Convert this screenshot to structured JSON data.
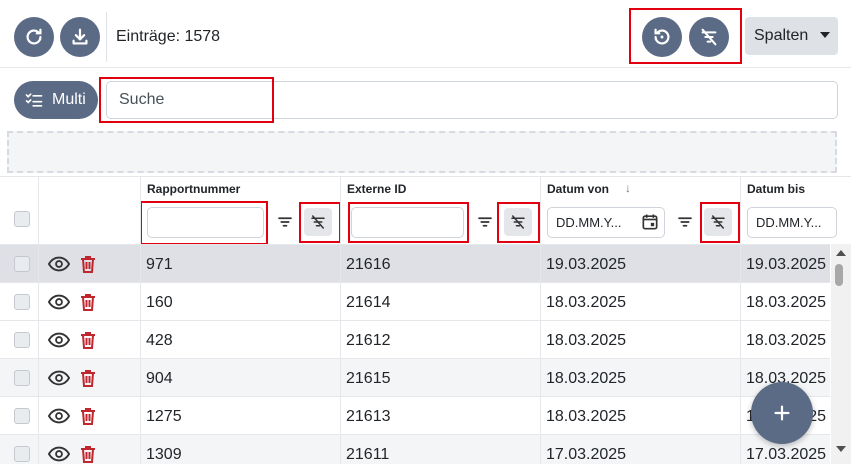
{
  "toolbar": {
    "entries_label": "Einträge: 1578",
    "columns_button_label": "Spalten"
  },
  "search": {
    "multi_label": "Multi",
    "placeholder": "Suche"
  },
  "table": {
    "columns": [
      {
        "key": "rapport",
        "label": "Rapportnummer",
        "filter_value": ""
      },
      {
        "key": "extern",
        "label": "Externe ID",
        "filter_value": ""
      },
      {
        "key": "von",
        "label": "Datum von",
        "filter_placeholder": "DD.MM.Y...",
        "sorted": "descending"
      },
      {
        "key": "bis",
        "label": "Datum bis",
        "filter_placeholder": "DD.MM.Y..."
      }
    ],
    "rows": [
      {
        "rapport": "971",
        "extern": "21616",
        "von": "19.03.2025",
        "bis": "19.03.2025",
        "selected": true
      },
      {
        "rapport": "160",
        "extern": "21614",
        "von": "18.03.2025",
        "bis": "18.03.2025"
      },
      {
        "rapport": "428",
        "extern": "21612",
        "von": "18.03.2025",
        "bis": "18.03.2025"
      },
      {
        "rapport": "904",
        "extern": "21615",
        "von": "18.03.2025",
        "bis": "18.03.2025"
      },
      {
        "rapport": "1275",
        "extern": "21613",
        "von": "18.03.2025",
        "bis": "18.03.2025"
      },
      {
        "rapport": "1309",
        "extern": "21611",
        "von": "17.03.2025",
        "bis": "17.03.2025"
      }
    ]
  },
  "icons": {
    "refresh": "refresh-icon",
    "download": "download-icon",
    "reset": "reset-icon",
    "clear_filter": "filter-off-icon",
    "filter": "filter-icon",
    "calendar": "calendar-icon",
    "view": "eye-icon",
    "delete": "trash-icon",
    "add": "plus-icon",
    "multi": "checklist-icon"
  },
  "colors": {
    "primary": "#5b6b86",
    "highlight_box": "#e0000f",
    "delete": "#c0262d",
    "selected_row": "#dee0e5"
  }
}
